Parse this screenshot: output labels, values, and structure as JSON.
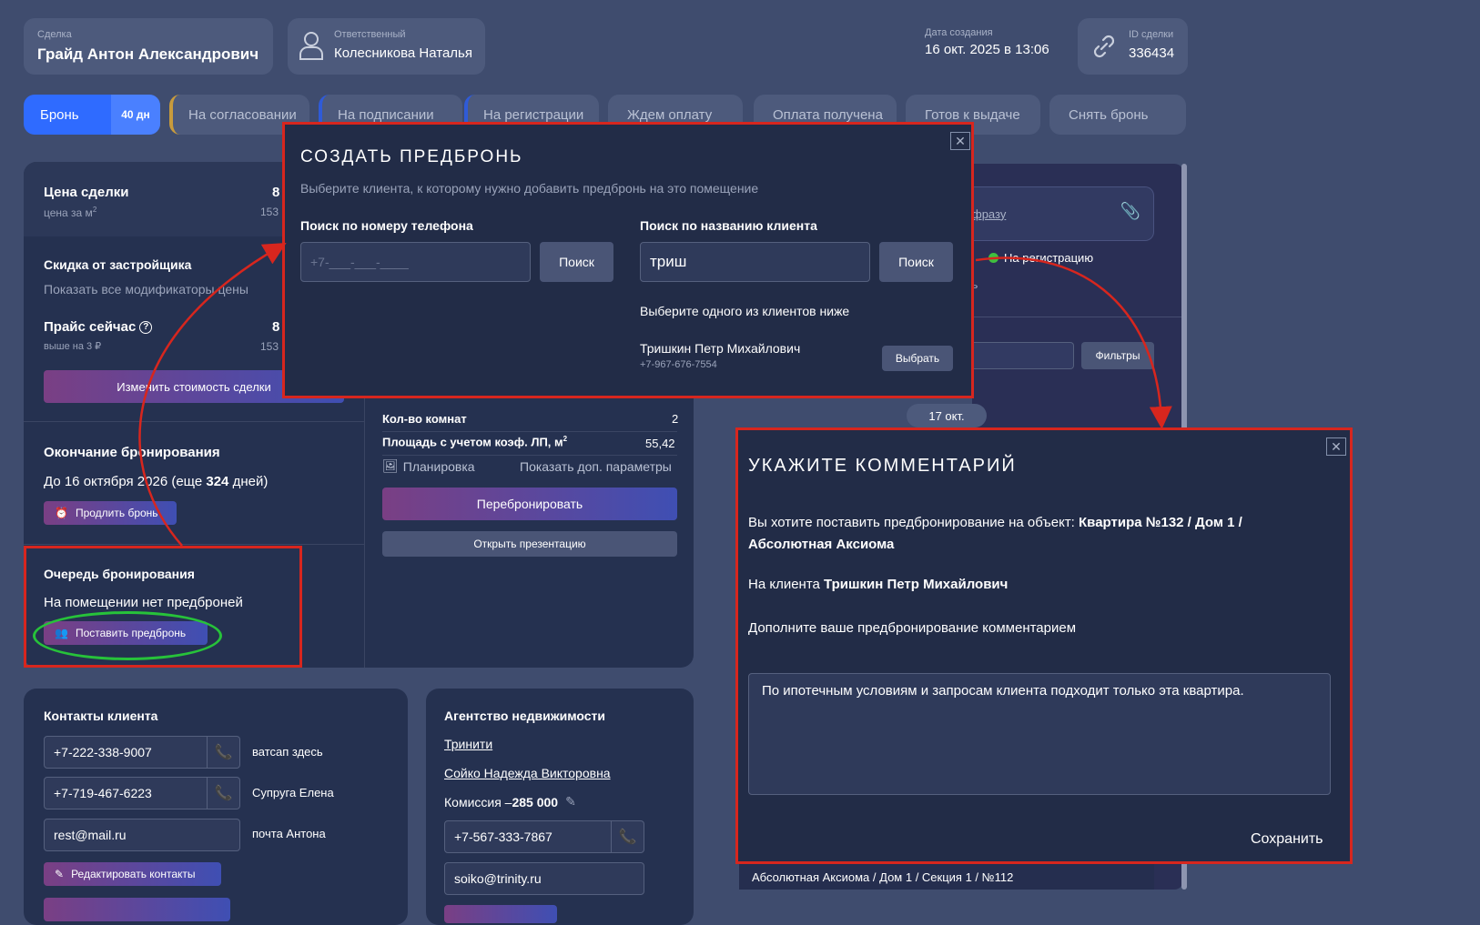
{
  "header": {
    "deal_label": "Сделка",
    "deal_value": "Грайд Антон Александрович",
    "resp_label": "Ответственный",
    "resp_value": "Колесникова Наталья",
    "created_label": "Дата создания",
    "created_value": "16 окт. 2025 в 13:06",
    "id_label": "ID сделки",
    "id_value": "336434"
  },
  "tabs": {
    "active": "Бронь",
    "active_badge": "40 дн",
    "t1": "На согласовании",
    "t2": "На подписании",
    "t3": "На регистрации",
    "t4": "Ждем оплату",
    "t5": "Оплата получена",
    "t6": "Готов к выдаче",
    "t7": "Снять бронь"
  },
  "price": {
    "title": "Цена сделки",
    "per_m2": "цена за м",
    "per_m2_sup": "2",
    "val1": "8",
    "val2": "153",
    "discount_title": "Скидка от застройщика",
    "show_mods": "Показать все модификаторы цены",
    "now_title": "Прайс сейчас",
    "now_sub": "выше на 3 ₽",
    "now_val1": "8",
    "now_val2": "153",
    "change_btn": "Изменить стоимость сделки"
  },
  "booking_end": {
    "title": "Окончание бронирования",
    "text_pre": "До 16 октября 2026 (еще ",
    "days": "324",
    "text_post": " дней)",
    "extend_btn": "Продлить бронь"
  },
  "queue": {
    "title": "Очередь бронирования",
    "text": "На помещении нет предброней",
    "btn": "Поставить предбронь"
  },
  "params": {
    "rooms_label": "Кол-во комнат",
    "rooms_value": "2",
    "area_label": "Площадь с учетом коэф. ЛП, м",
    "area_sup": "2",
    "area_value": "55,42",
    "layout_link": "Планировка",
    "more_link": "Показать доп. параметры",
    "rebook_btn": "Перебронировать",
    "presentation_btn": "Открыть презентацию"
  },
  "right_panel": {
    "search_frag": "фразу",
    "status": "На регистрацию",
    "frag2": "ь",
    "filters_btn": "Фильтры",
    "date_chip": "17 окт.",
    "footer_text": "Абсолютная Аксиома / Дом 1 / Секция 1 / №112"
  },
  "contacts": {
    "title": "Контакты клиента",
    "phone1": "+7-222-338-9007",
    "note1": "ватсап здесь",
    "phone2": "+7-719-467-6223",
    "note2": "Супруга Елена",
    "email": "rest@mail.ru",
    "note3": "почта Антона",
    "edit_btn": "Редактировать контакты"
  },
  "agency": {
    "title": "Агентство недвижимости",
    "name": "Тринити",
    "agent": "Сойко Надежда Викторовна",
    "commission_pre": "Комиссия – ",
    "commission": "285 000",
    "phone": "+7-567-333-7867",
    "email": "soiko@trinity.ru"
  },
  "modal1": {
    "title": "СОЗДАТЬ ПРЕДБРОНЬ",
    "subtitle": "Выберите клиента, к которому нужно добавить предбронь на это помещение",
    "phone_label": "Поиск по номеру телефона",
    "phone_placeholder": "+7-___-___-____",
    "search_btn": "Поиск",
    "name_label": "Поиск по названию клиента",
    "name_value": "триш",
    "search_btn2": "Поиск",
    "pick_hint": "Выберите одного из клиентов ниже",
    "client_name": "Тришкин Петр Михайлович",
    "client_phone": "+7-967-676-7554",
    "pick_btn": "Выбрать"
  },
  "modal2": {
    "title": "УКАЖИТЕ КОММЕНТАРИЙ",
    "line1_pre": "Вы хотите поставить предбронирование на объект: ",
    "line1_bold": "Квартира №132 / Дом 1 / Абсолютная Аксиома",
    "line2_pre": "На клиента ",
    "line2_bold": "Тришкин Петр Михайлович",
    "line3": "Дополните ваше предбронирование комментарием",
    "comment": "По ипотечным условиям и запросам клиента подходит только эта квартира.",
    "save_btn": "Сохранить"
  },
  "colors": {
    "accent_blue": "#2f6bff",
    "highlight_red": "#d7261e",
    "highlight_green": "#27c23a",
    "status_green": "#3fbf3f"
  }
}
